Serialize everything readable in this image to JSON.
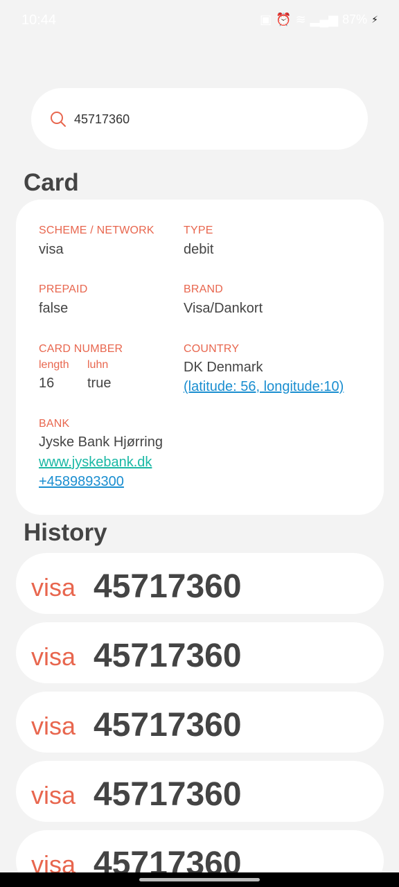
{
  "status_bar": {
    "time": "10:44",
    "battery": "87%"
  },
  "search": {
    "value": "45717360"
  },
  "card_section": {
    "title": "Card",
    "scheme_label": "SCHEME / NETWORK",
    "scheme_value": "visa",
    "type_label": "TYPE",
    "type_value": "debit",
    "prepaid_label": "PREPAID",
    "prepaid_value": "false",
    "brand_label": "BRAND",
    "brand_value": "Visa/Dankort",
    "card_number_label": "CARD NUMBER",
    "length_label": "length",
    "length_value": "16",
    "luhn_label": "luhn",
    "luhn_value": "true",
    "country_label": "COUNTRY",
    "country_value": "DK Denmark",
    "country_coords": "(latitude: 56, longitude:10)",
    "bank_label": "BANK",
    "bank_name": "Jyske Bank Hjørring",
    "bank_url": "www.jyskebank.dk",
    "bank_phone": "+4589893300"
  },
  "history_section": {
    "title": "History",
    "items": [
      {
        "scheme": "visa",
        "number": "45717360"
      },
      {
        "scheme": "visa",
        "number": "45717360"
      },
      {
        "scheme": "visa",
        "number": "45717360"
      },
      {
        "scheme": "visa",
        "number": "45717360"
      },
      {
        "scheme": "visa",
        "number": "45717360"
      }
    ]
  },
  "colors": {
    "accent": "#e8664e",
    "link": "#1a8ed0",
    "link_alt": "#19b8a4",
    "background": "#f3f3f3"
  }
}
